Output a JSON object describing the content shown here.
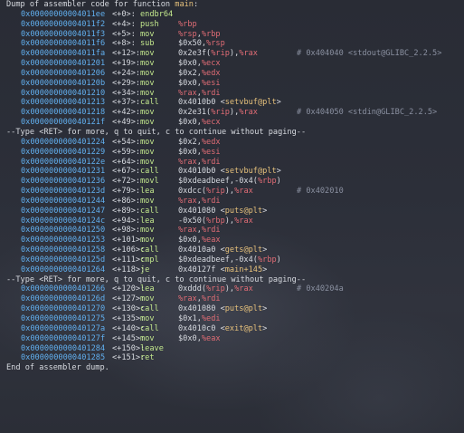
{
  "header": {
    "prefix": "Dump of assembler code for function ",
    "function": "main",
    "suffix": ":"
  },
  "instructions": [
    {
      "addr": "0x00000000004011ee",
      "off": "<+0>:",
      "mn": "endbr64",
      "op": [],
      "comment": ""
    },
    {
      "addr": "0x00000000004011f2",
      "off": "<+4>:",
      "mn": "push",
      "op": [
        [
          "reg",
          "%rbp"
        ]
      ],
      "comment": ""
    },
    {
      "addr": "0x00000000004011f3",
      "off": "<+5>:",
      "mn": "mov",
      "op": [
        [
          "reg",
          "%rsp"
        ],
        [
          "t",
          ","
        ],
        [
          "reg",
          "%rbp"
        ]
      ],
      "comment": ""
    },
    {
      "addr": "0x00000000004011f6",
      "off": "<+8>:",
      "mn": "sub",
      "op": [
        [
          "t",
          "$0x50,"
        ],
        [
          "reg",
          "%rsp"
        ]
      ],
      "comment": ""
    },
    {
      "addr": "0x00000000004011fa",
      "off": "<+12>:",
      "mn": "mov",
      "op": [
        [
          "t",
          "0x2e3f("
        ],
        [
          "reg",
          "%rip"
        ],
        [
          "t",
          "),"
        ],
        [
          "reg",
          "%rax"
        ]
      ],
      "comment": "# 0x404040 <stdout@GLIBC_2.2.5>"
    },
    {
      "addr": "0x0000000000401201",
      "off": "<+19>:",
      "mn": "mov",
      "op": [
        [
          "t",
          "$0x0,"
        ],
        [
          "reg",
          "%ecx"
        ]
      ],
      "comment": ""
    },
    {
      "addr": "0x0000000000401206",
      "off": "<+24>:",
      "mn": "mov",
      "op": [
        [
          "t",
          "$0x2,"
        ],
        [
          "reg",
          "%edx"
        ]
      ],
      "comment": ""
    },
    {
      "addr": "0x000000000040120b",
      "off": "<+29>:",
      "mn": "mov",
      "op": [
        [
          "t",
          "$0x0,"
        ],
        [
          "reg",
          "%esi"
        ]
      ],
      "comment": ""
    },
    {
      "addr": "0x0000000000401210",
      "off": "<+34>:",
      "mn": "mov",
      "op": [
        [
          "reg",
          "%rax"
        ],
        [
          "t",
          ","
        ],
        [
          "reg",
          "%rdi"
        ]
      ],
      "comment": ""
    },
    {
      "addr": "0x0000000000401213",
      "off": "<+37>:",
      "mn": "call",
      "op": [
        [
          "t",
          "0x4010b0 <"
        ],
        [
          "sym",
          "setvbuf@plt"
        ],
        [
          "t",
          ">"
        ]
      ],
      "comment": ""
    },
    {
      "addr": "0x0000000000401218",
      "off": "<+42>:",
      "mn": "mov",
      "op": [
        [
          "t",
          "0x2e31("
        ],
        [
          "reg",
          "%rip"
        ],
        [
          "t",
          "),"
        ],
        [
          "reg",
          "%rax"
        ]
      ],
      "comment": "# 0x404050 <stdin@GLIBC_2.2.5>"
    },
    {
      "addr": "0x000000000040121f",
      "off": "<+49>:",
      "mn": "mov",
      "op": [
        [
          "t",
          "$0x0,"
        ],
        [
          "reg",
          "%ecx"
        ]
      ],
      "comment": ""
    },
    {
      "type": "pager",
      "text": "--Type <RET> for more, q to quit, c to continue without paging--"
    },
    {
      "addr": "0x0000000000401224",
      "off": "<+54>:",
      "mn": "mov",
      "op": [
        [
          "t",
          "$0x2,"
        ],
        [
          "reg",
          "%edx"
        ]
      ],
      "comment": ""
    },
    {
      "addr": "0x0000000000401229",
      "off": "<+59>:",
      "mn": "mov",
      "op": [
        [
          "t",
          "$0x0,"
        ],
        [
          "reg",
          "%esi"
        ]
      ],
      "comment": ""
    },
    {
      "addr": "0x000000000040122e",
      "off": "<+64>:",
      "mn": "mov",
      "op": [
        [
          "reg",
          "%rax"
        ],
        [
          "t",
          ","
        ],
        [
          "reg",
          "%rdi"
        ]
      ],
      "comment": ""
    },
    {
      "addr": "0x0000000000401231",
      "off": "<+67>:",
      "mn": "call",
      "op": [
        [
          "t",
          "0x4010b0 <"
        ],
        [
          "sym",
          "setvbuf@plt"
        ],
        [
          "t",
          ">"
        ]
      ],
      "comment": ""
    },
    {
      "addr": "0x0000000000401236",
      "off": "<+72>:",
      "mn": "movl",
      "op": [
        [
          "t",
          "$0xdeadbeef,-0x4("
        ],
        [
          "reg",
          "%rbp"
        ],
        [
          "t",
          ")"
        ]
      ],
      "comment": ""
    },
    {
      "addr": "0x000000000040123d",
      "off": "<+79>:",
      "mn": "lea",
      "op": [
        [
          "t",
          "0xdcc("
        ],
        [
          "reg",
          "%rip"
        ],
        [
          "t",
          "),"
        ],
        [
          "reg",
          "%rax"
        ]
      ],
      "comment": "# 0x402010"
    },
    {
      "addr": "0x0000000000401244",
      "off": "<+86>:",
      "mn": "mov",
      "op": [
        [
          "reg",
          "%rax"
        ],
        [
          "t",
          ","
        ],
        [
          "reg",
          "%rdi"
        ]
      ],
      "comment": ""
    },
    {
      "addr": "0x0000000000401247",
      "off": "<+89>:",
      "mn": "call",
      "op": [
        [
          "t",
          "0x401080 <"
        ],
        [
          "sym",
          "puts@plt"
        ],
        [
          "t",
          ">"
        ]
      ],
      "comment": ""
    },
    {
      "addr": "0x000000000040124c",
      "off": "<+94>:",
      "mn": "lea",
      "op": [
        [
          "t",
          "-0x50("
        ],
        [
          "reg",
          "%rbp"
        ],
        [
          "t",
          "),"
        ],
        [
          "reg",
          "%rax"
        ]
      ],
      "comment": ""
    },
    {
      "addr": "0x0000000000401250",
      "off": "<+98>:",
      "mn": "mov",
      "op": [
        [
          "reg",
          "%rax"
        ],
        [
          "t",
          ","
        ],
        [
          "reg",
          "%rdi"
        ]
      ],
      "comment": ""
    },
    {
      "addr": "0x0000000000401253",
      "off": "<+101>:",
      "mn": "mov",
      "op": [
        [
          "t",
          "$0x0,"
        ],
        [
          "reg",
          "%eax"
        ]
      ],
      "comment": ""
    },
    {
      "addr": "0x0000000000401258",
      "off": "<+106>:",
      "mn": "call",
      "op": [
        [
          "t",
          "0x4010a0 <"
        ],
        [
          "sym",
          "gets@plt"
        ],
        [
          "t",
          ">"
        ]
      ],
      "comment": ""
    },
    {
      "addr": "0x000000000040125d",
      "off": "<+111>:",
      "mn": "cmpl",
      "op": [
        [
          "t",
          "$0xdeadbeef,-0x4("
        ],
        [
          "reg",
          "%rbp"
        ],
        [
          "t",
          ")"
        ]
      ],
      "comment": ""
    },
    {
      "addr": "0x0000000000401264",
      "off": "<+118>:",
      "mn": "je",
      "op": [
        [
          "t",
          "0x40127f <"
        ],
        [
          "sym",
          "main+145"
        ],
        [
          "t",
          ">"
        ]
      ],
      "comment": ""
    },
    {
      "type": "pager",
      "text": "--Type <RET> for more, q to quit, c to continue without paging--"
    },
    {
      "addr": "0x0000000000401266",
      "off": "<+120>:",
      "mn": "lea",
      "op": [
        [
          "t",
          "0xddd("
        ],
        [
          "reg",
          "%rip"
        ],
        [
          "t",
          "),"
        ],
        [
          "reg",
          "%rax"
        ]
      ],
      "comment": "# 0x40204a"
    },
    {
      "addr": "0x000000000040126d",
      "off": "<+127>:",
      "mn": "mov",
      "op": [
        [
          "reg",
          "%rax"
        ],
        [
          "t",
          ","
        ],
        [
          "reg",
          "%rdi"
        ]
      ],
      "comment": ""
    },
    {
      "addr": "0x0000000000401270",
      "off": "<+130>:",
      "mn": "call",
      "op": [
        [
          "t",
          "0x401080 <"
        ],
        [
          "sym",
          "puts@plt"
        ],
        [
          "t",
          ">"
        ]
      ],
      "comment": ""
    },
    {
      "addr": "0x0000000000401275",
      "off": "<+135>:",
      "mn": "mov",
      "op": [
        [
          "t",
          "$0x1,"
        ],
        [
          "reg",
          "%edi"
        ]
      ],
      "comment": ""
    },
    {
      "addr": "0x000000000040127a",
      "off": "<+140>:",
      "mn": "call",
      "op": [
        [
          "t",
          "0x4010c0 <"
        ],
        [
          "sym",
          "exit@plt"
        ],
        [
          "t",
          ">"
        ]
      ],
      "comment": ""
    },
    {
      "addr": "0x000000000040127f",
      "off": "<+145>:",
      "mn": "mov",
      "op": [
        [
          "t",
          "$0x0,"
        ],
        [
          "reg",
          "%eax"
        ]
      ],
      "comment": ""
    },
    {
      "addr": "0x0000000000401284",
      "off": "<+150>:",
      "mn": "leave",
      "op": [],
      "comment": ""
    },
    {
      "addr": "0x0000000000401285",
      "off": "<+151>:",
      "mn": "ret",
      "op": [],
      "comment": ""
    }
  ],
  "footer": "End of assembler dump.",
  "colors": {
    "address": "#61afef",
    "mnemonic": "#c3e88d",
    "register": "#e06c75",
    "symbol": "#e5c07b",
    "comment": "#8a90a0",
    "text": "#d7dae0"
  }
}
